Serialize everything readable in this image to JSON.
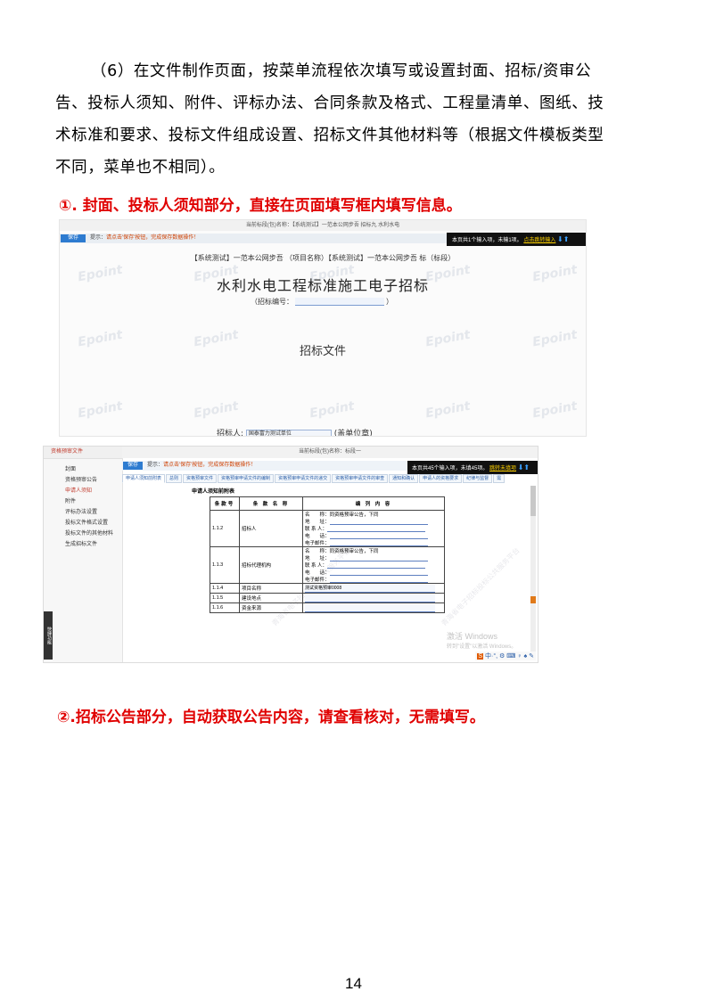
{
  "paragraph": {
    "line1": "（6）在文件制作页面，按菜单流程依次填写或设置封面、招标/资审公",
    "line2": "告、投标人须知、附件、评标办法、合同条款及格式、工程量清单、图纸、技",
    "line3": "术标准和要求、投标文件组成设置、招标文件其他材料等（根据文件模板类型",
    "line4": "不同，菜单也不相同）。"
  },
  "heading1": "①. 封面、投标人须知部分，直接在页面填写框内填写信息。",
  "heading2": "②.招标公告部分，自动获取公告内容，请查看核对，无需填写。",
  "page_number": "14",
  "screenshot1": {
    "top_title": "当前标段(包)名称：【系统测试】一范本公网步吾 招标九 水利水电",
    "save_button": "保存",
    "tip_label": "提示：",
    "tip_text": "请点击'保存'按钮，完成保存数据操作！",
    "notice": "本页共1个输入项，未输1项。",
    "notice_link": "点击跳转输入",
    "subtitle": "【系统测试】一范本公网步吾 （项目名称）【系统测试】一范本公网步吾 标（标段）",
    "title": "水利水电工程标准施工电子招标",
    "number_label_pre": "（招标编号：",
    "number_label_post": "）",
    "doc_label": "招标文件",
    "tenderer_label": "招标人:",
    "tenderer_value": "国泰富力测试单位",
    "tenderer_suffix": "(盖单位章)",
    "watermark": "Epoint"
  },
  "screenshot2": {
    "sidebar_head": "资格预审文件",
    "sidebar_items": [
      "封面",
      "资格预审公告",
      "申请人须知",
      "附件",
      "评标办法设置",
      "投标文件格式设置",
      "投标文件的其他材料",
      "生成招标文件"
    ],
    "quick_tab": "快捷功能",
    "top_title": "当前标段(包)名称：标段一",
    "save_button": "保存",
    "tip_label": "提示：",
    "tip_text": "请点击'保存'按钮，完成保存数据操作！",
    "notice": "本页共45个输入项，未填45项。",
    "notice_link": "跳转未填项",
    "tabs": [
      "申请人须知前附表",
      "总则",
      "资格预审文件",
      "资格预审申请文件的编制",
      "资格预审申请文件的递交",
      "资格预审申请文件的审查",
      "通知和确认",
      "申请人的资格要求",
      "纪律与监督",
      "需"
    ],
    "table_title": "申请人须知前附表",
    "table_headers": [
      "条款号",
      "条 款 名 称",
      "编 列 内 容"
    ],
    "rows": [
      {
        "no": "1.1.2",
        "name": "招标人",
        "lines": [
          "名　　称：同资格预审公告，下同",
          "地　　址：",
          "联 系 人：",
          "电　　话：",
          "电子邮件："
        ]
      },
      {
        "no": "1.1.3",
        "name": "招标代理机构",
        "lines": [
          "名　　称：同资格预审公告，下同",
          "地　　址：",
          "联 系 人：",
          "电　　话：",
          "电子邮件："
        ]
      },
      {
        "no": "1.1.4",
        "name": "项目名称",
        "fill": "测试资格预审0008"
      },
      {
        "no": "1.1.5",
        "name": "建设地点",
        "fill": ""
      },
      {
        "no": "1.1.6",
        "name": "资金来源",
        "fill": ""
      }
    ],
    "watermark": "青海省电子招标投标公共服务平台",
    "win_line1": "激活 Windows",
    "win_line2": "转到\"设置\"以激活 Windows。",
    "ime_text": "中·°, ⚙ ⌨ ♀ ♠ ✎"
  }
}
